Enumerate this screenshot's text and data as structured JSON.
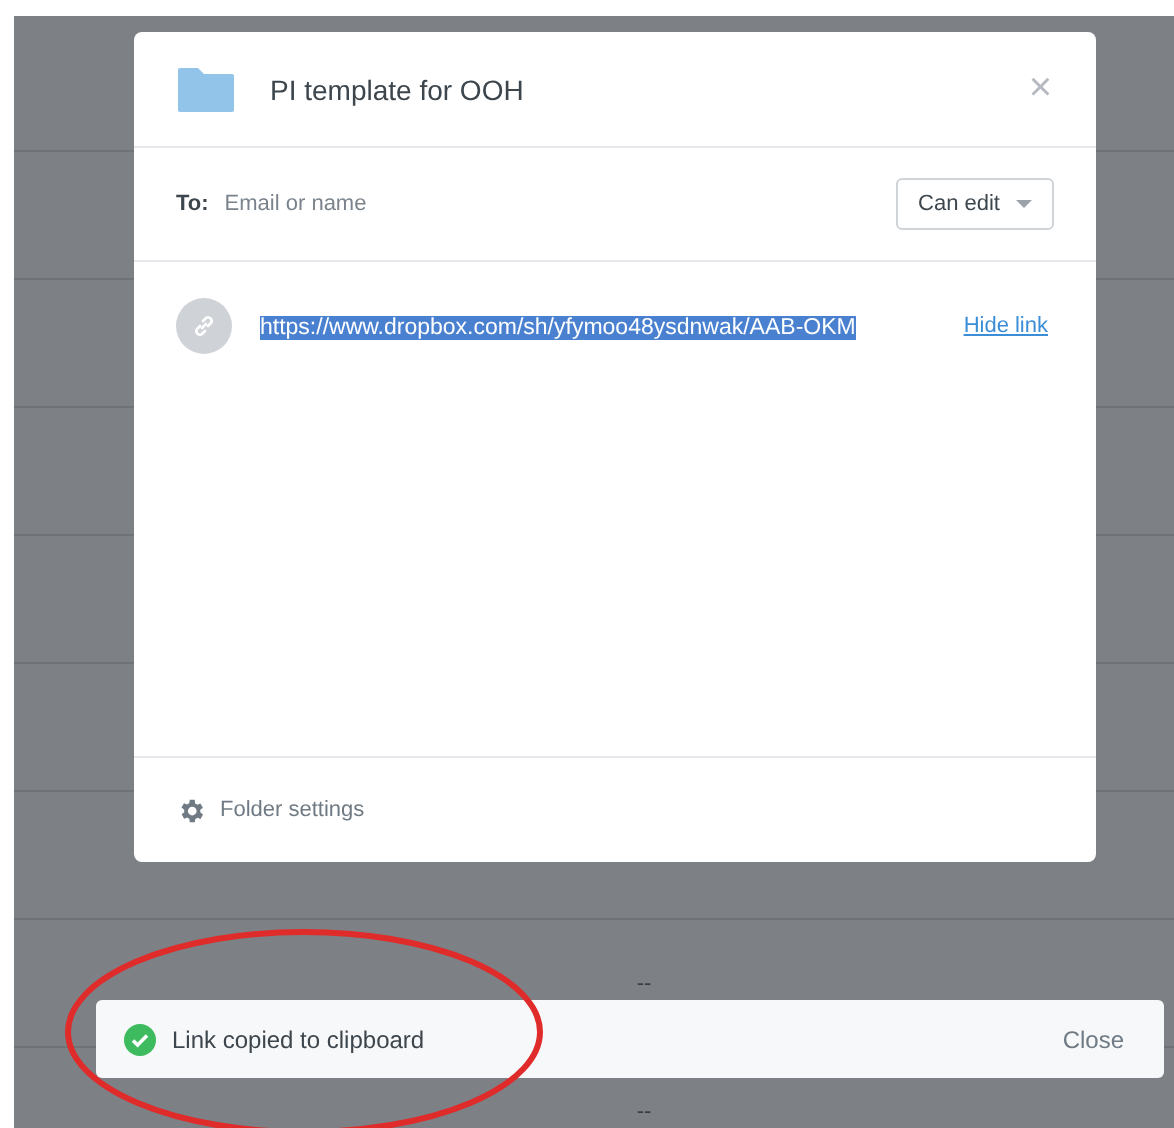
{
  "background_rows": [
    {
      "cell": "--"
    },
    {
      "cell": "--"
    }
  ],
  "dialog": {
    "title": "PI template for OOH",
    "close": "×",
    "to_label": "To:",
    "to_placeholder": "Email or name",
    "permission": "Can edit",
    "link": {
      "url": "https://www.dropbox.com/sh/yfymoo48ysdnwak/AAB-OKM",
      "selected": true,
      "action": "Hide link"
    },
    "footer": "Folder settings"
  },
  "toast": {
    "message": "Link copied to clipboard",
    "close": "Close"
  },
  "annotation": {
    "kind": "ellipse"
  }
}
